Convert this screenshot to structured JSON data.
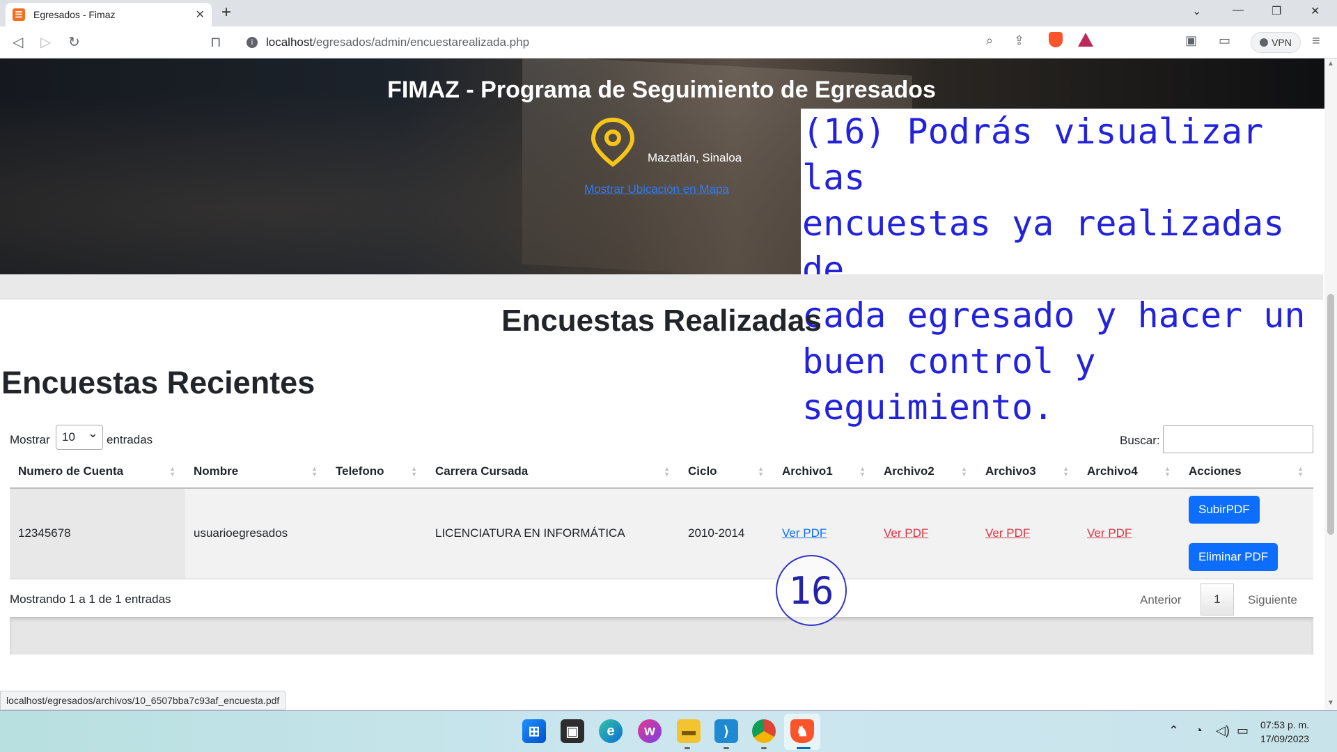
{
  "browser": {
    "tab_title": "Egresados - Fimaz",
    "tab_favicon": "xampp-icon",
    "url_host": "localhost",
    "url_path": "/egresados/admin/encuestarealizada.php",
    "vpn_label": "VPN"
  },
  "hero": {
    "title": "FIMAZ - Programa de Seguimiento de Egresados",
    "location": "Mazatlán, Sinaloa",
    "map_link": "Mostrar Ubicación en Mapa"
  },
  "callout": "(16) Podrás visualizar las\nencuestas ya realizadas de\ncada egresado y hacer un\nbuen control y seguimiento.",
  "page": {
    "heading": "Encuestas Realizadas",
    "subheading": "Encuestas Recientes"
  },
  "table_controls": {
    "show_label": "Mostrar",
    "length_value": "10",
    "entries_label": "entradas",
    "search_label": "Buscar:"
  },
  "table": {
    "columns": [
      "Numero de Cuenta",
      "Nombre",
      "Telefono",
      "Carrera Cursada",
      "Ciclo",
      "Archivo1",
      "Archivo2",
      "Archivo3",
      "Archivo4",
      "Acciones"
    ],
    "rows": [
      {
        "cuenta": "12345678",
        "nombre": "usuarioegresados",
        "telefono": "",
        "carrera": "LICENCIATURA EN INFORMÁTICA",
        "ciclo": "2010-2014",
        "archivo1": "Ver PDF",
        "archivo2": "Ver PDF",
        "archivo3": "Ver PDF",
        "archivo4": "Ver PDF",
        "upload_button": "SubirPDF",
        "delete_button": "Eliminar PDF"
      }
    ],
    "info": "Mostrando 1 a 1 de 1 entradas",
    "prev": "Anterior",
    "page": "1",
    "next": "Siguiente"
  },
  "step_badge": "16",
  "status_url": "localhost/egresados/archivos/10_6507bba7c93af_encuesta.pdf",
  "taskbar": {
    "time": "07:53 p. m.",
    "date": "17/09/2023"
  },
  "colors": {
    "link_blue": "#0d6efd",
    "link_red": "#dc3545",
    "callout_text": "#2222dd",
    "pin_yellow": "#f5c518"
  }
}
